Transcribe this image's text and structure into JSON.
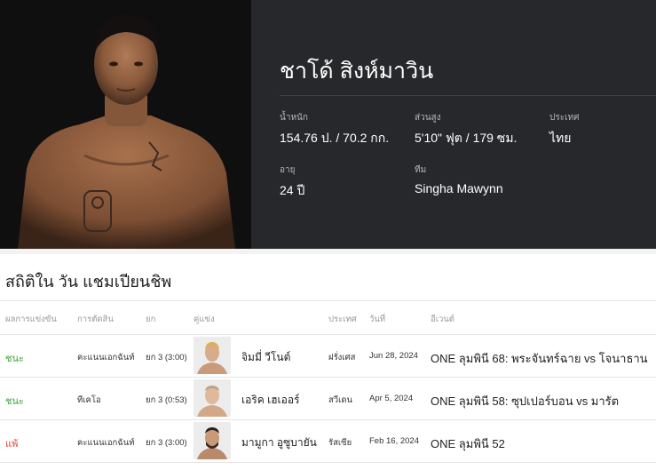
{
  "fighter": {
    "name": "ชาโด้ สิงห์มาวิน",
    "stats": {
      "weight_label": "น้ำหนัก",
      "weight_value": "154.76 ป. / 70.2 กก.",
      "height_label": "ส่วนสูง",
      "height_value": "5'10\" ฟุต / 179 ซม.",
      "country_label": "ประเทศ",
      "country_value": "ไทย",
      "age_label": "อายุ",
      "age_value": "24 ปี",
      "team_label": "ทีม",
      "team_value": "Singha Mawynn"
    }
  },
  "record": {
    "title": "สถิติใน วัน แชมเปียนชิพ",
    "headers": {
      "result": "ผลการแข่งขัน",
      "method": "การตัดสิน",
      "round": "ยก",
      "opponent": "คู่แข่ง",
      "country": "ประเทศ",
      "date": "วันที่",
      "event": "อีเวนต์"
    },
    "rows": [
      {
        "result": "ชนะ",
        "method": "คะแนนเอกฉันท์",
        "round": "ยก 3 (3:00)",
        "opponent": "จิมมี่ วีโนต์",
        "country": "ฝรั่งเศส",
        "date": "Jun 28, 2024",
        "event": "ONE ลุมพินี 68: พระจันทร์ฉาย vs โจนาธาน",
        "result_color": "#3aa53a"
      },
      {
        "result": "ชนะ",
        "method": "ทีเคโอ",
        "round": "ยก 3 (0:53)",
        "opponent": "เอริค เฮเออร์",
        "country": "สวีเดน",
        "date": "Apr 5, 2024",
        "event": "ONE ลุมพินี 58: ซุปเปอร์บอน vs มารัต",
        "result_color": "#3aa53a"
      },
      {
        "result": "แพ้",
        "method": "คะแนนเอกฉันท์",
        "round": "ยก 3 (3:00)",
        "opponent": "มามูกา อูซูบายัน",
        "country": "รัสเซีย",
        "date": "Feb 16, 2024",
        "event": "ONE ลุมพินี 52",
        "result_color": "#d9463b"
      }
    ]
  }
}
